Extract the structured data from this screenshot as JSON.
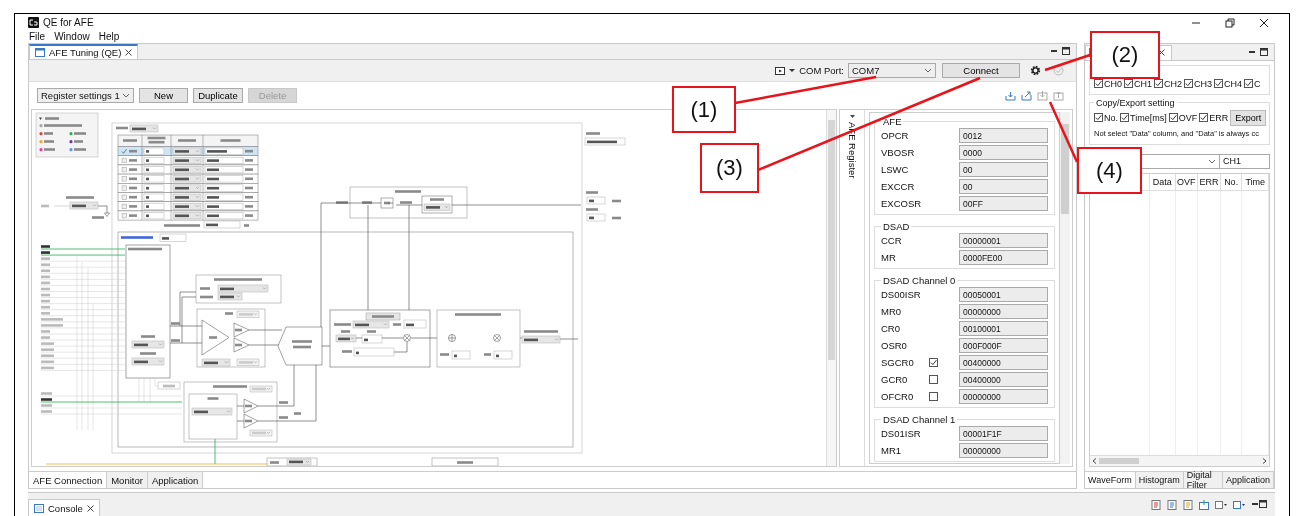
{
  "window": {
    "title": "QE for AFE"
  },
  "menu": [
    "File",
    "Window",
    "Help"
  ],
  "editor": {
    "tab": "AFE Tuning (QE)",
    "com_port_label": "COM Port:",
    "com_port": "COM7",
    "connect": "Connect",
    "register_set": "Register settings 1",
    "buttons": [
      {
        "label": "New",
        "disabled": false
      },
      {
        "label": "Duplicate",
        "disabled": false
      },
      {
        "label": "Delete",
        "disabled": true
      }
    ],
    "register_panel": {
      "title": "AFE Register",
      "groups": [
        {
          "title": "AFE",
          "registers": [
            {
              "name": "OPCR",
              "value": "0012",
              "kind": "plain"
            },
            {
              "name": "VBOSR",
              "value": "0000",
              "kind": "plain"
            },
            {
              "name": "LSWC",
              "value": "00",
              "kind": "plain"
            },
            {
              "name": "EXCCR",
              "value": "00",
              "kind": "plain"
            },
            {
              "name": "EXCOSR",
              "value": "00FF",
              "kind": "plain"
            }
          ]
        },
        {
          "title": "DSAD",
          "registers": [
            {
              "name": "CCR",
              "value": "00000001",
              "kind": "plain"
            },
            {
              "name": "MR",
              "value": "0000FE00",
              "kind": "plain"
            }
          ]
        },
        {
          "title": "DSAD Channel 0",
          "registers": [
            {
              "name": "DS00ISR",
              "value": "00050001",
              "kind": "plain"
            },
            {
              "name": "MR0",
              "value": "00000000",
              "kind": "plain"
            },
            {
              "name": "CR0",
              "value": "00100001",
              "kind": "plain"
            },
            {
              "name": "OSR0",
              "value": "000F000F",
              "kind": "plain"
            },
            {
              "name": "SGCR0",
              "value": "00400000",
              "kind": "checkbox",
              "checked": true
            },
            {
              "name": "GCR0",
              "value": "00400000",
              "kind": "checkbox",
              "checked": false
            },
            {
              "name": "OFCR0",
              "value": "00000000",
              "kind": "checkbox",
              "checked": false
            }
          ]
        },
        {
          "title": "DSAD Channel 1",
          "registers": [
            {
              "name": "DS01ISR",
              "value": "00001F1F",
              "kind": "plain"
            },
            {
              "name": "MR1",
              "value": "00000000",
              "kind": "plain"
            }
          ]
        }
      ]
    },
    "bottom_tabs": [
      {
        "label": "AFE Connection",
        "selected": true
      },
      {
        "label": "Monitor",
        "selected": false
      },
      {
        "label": "Application",
        "selected": false
      }
    ]
  },
  "monitor": {
    "channels": [
      {
        "label": "CH0",
        "checked": true
      },
      {
        "label": "CH1",
        "checked": true
      },
      {
        "label": "CH2",
        "checked": true
      },
      {
        "label": "CH3",
        "checked": true
      },
      {
        "label": "CH4",
        "checked": true
      },
      {
        "label": "C",
        "checked": true
      }
    ],
    "export": {
      "title": "Copy/Export setting",
      "options": [
        {
          "label": "No.",
          "checked": true
        },
        {
          "label": "Time[ms]",
          "checked": true
        },
        {
          "label": "OVF",
          "checked": true
        },
        {
          "label": "ERR",
          "checked": true
        }
      ],
      "button": "Export"
    },
    "note": "Not select \"Data\" column, and \"Data\" is always cc",
    "channel_field": "CH1",
    "columns": [
      "Data",
      "OVF",
      "ERR",
      "No.",
      "Time"
    ],
    "tabs": [
      {
        "label": "WaveForm",
        "selected": true
      },
      {
        "label": "Histogram",
        "selected": false
      },
      {
        "label": "Digital Filter",
        "selected": false
      },
      {
        "label": "Application",
        "selected": false
      }
    ]
  },
  "console": {
    "tab": "Console"
  },
  "callouts": [
    "(1)",
    "(2)",
    "(3)",
    "(4)"
  ]
}
